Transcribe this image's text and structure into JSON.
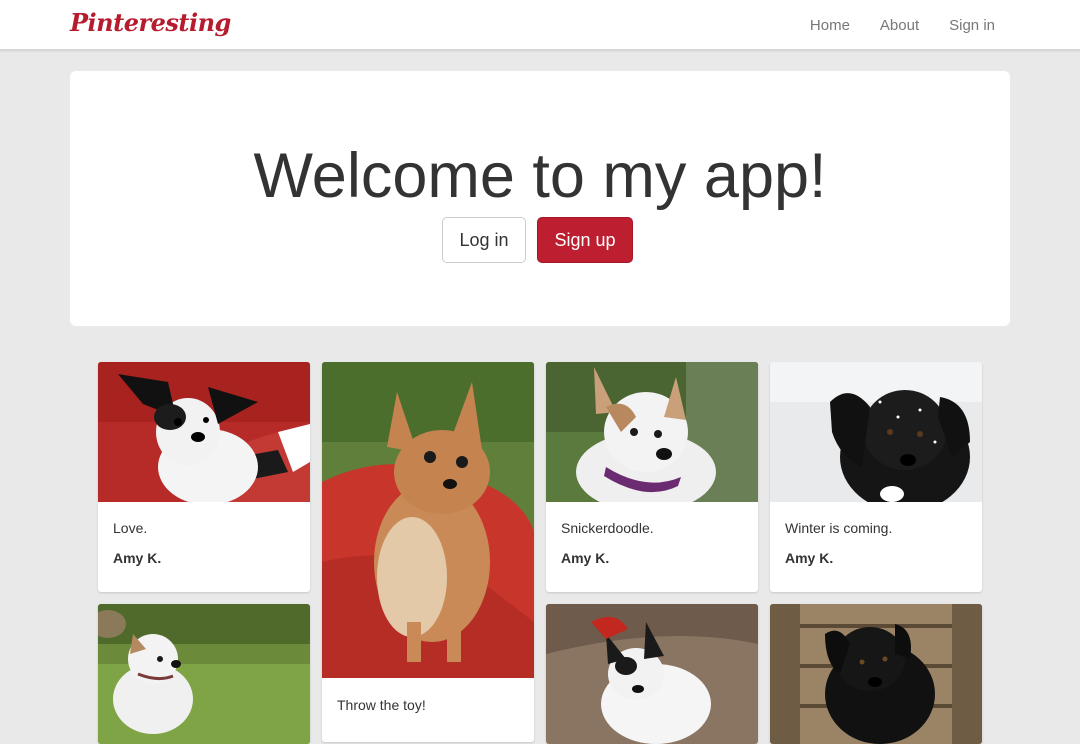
{
  "navbar": {
    "brand": "Pinteresting",
    "links": [
      "Home",
      "About",
      "Sign in"
    ]
  },
  "jumbotron": {
    "title": "Welcome to my app!",
    "login_label": "Log in",
    "signup_label": "Sign up"
  },
  "pins": [
    {
      "description": "Love.",
      "author": "Amy K."
    },
    {
      "description": "Throw the toy!",
      "author": ""
    },
    {
      "description": "Snickerdoodle.",
      "author": "Amy K."
    },
    {
      "description": "Winter is coming.",
      "author": "Amy K."
    }
  ],
  "colors": {
    "brand": "#b71c2e",
    "signup_button": "#bd1e30",
    "background": "#e9e9e9"
  }
}
